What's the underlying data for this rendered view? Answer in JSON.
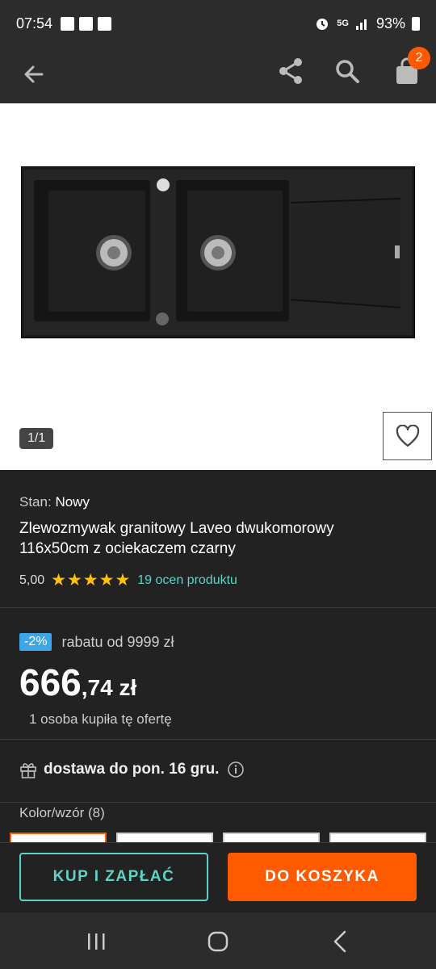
{
  "status": {
    "time": "07:54",
    "network": "5G",
    "battery": "93%"
  },
  "cart": {
    "count": "2"
  },
  "gallery": {
    "counter": "1/1"
  },
  "product": {
    "condition_label": "Stan:",
    "condition_value": "Nowy",
    "title": "Zlewozmywak granitowy Laveo dwukomorowy 116x50cm z ociekaczem czarny",
    "rating_value": "5,00",
    "stars": "★★★★★",
    "rating_out_of": 5,
    "reviews": "19 ocen produktu"
  },
  "pricing": {
    "discount_badge": "-2%",
    "discount_text": "rabatu od 9999 zł",
    "price_int": "666",
    "price_dec": ",74 zł",
    "buyers": "1 osoba kupiła tę ofertę"
  },
  "delivery": {
    "text": "dostawa do pon. 16 gru."
  },
  "variants": {
    "label": "Kolor/wzór (8)"
  },
  "actions": {
    "buy_label": "KUP I ZAPŁAĆ",
    "cart_label": "DO KOSZYKA"
  },
  "colors": {
    "accent_orange": "#ff5a00",
    "accent_teal": "#5fd3c4",
    "discount_blue": "#3ea5e7",
    "star_yellow": "#ffc107"
  }
}
